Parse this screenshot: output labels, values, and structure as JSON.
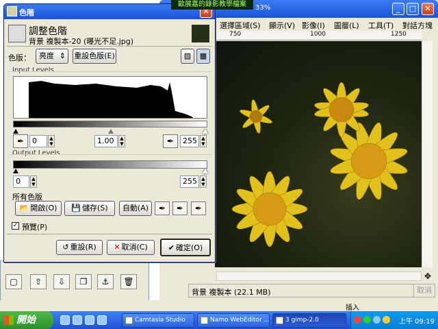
{
  "banner": {
    "text": "歐展嘉的錄影教學檔案"
  },
  "image_window": {
    "title_fragment": "33%",
    "menu": [
      "選擇區域(S)",
      "顯示(V)",
      "影像(I)",
      "圖層(L)",
      "工具(T)",
      "對話方塊"
    ],
    "ruler_ticks": [
      "750",
      "1000",
      "1250"
    ],
    "status": "背景 複製本 (22.1 MB)",
    "cancel": "取消"
  },
  "dialog": {
    "title": "色階",
    "header_title": "調整色階",
    "header_subtitle": "背景 複製本-20 (曝光不足.jpg)",
    "channel_label": "色版：",
    "channel_value": "亮度",
    "reset_channel": "重設色版(E)",
    "input_levels_label": "Input Levels",
    "input_low": "0",
    "input_gamma": "1.00",
    "input_high": "255",
    "output_levels_label": "Output Levels",
    "output_low": "0",
    "output_high": "255",
    "all_channels_label": "所有色版",
    "open_label": "開啟(O)",
    "save_label": "儲存(S)",
    "auto_label": "自動(A)",
    "preview_label": "預覽(P)",
    "reset_label": "重設(R)",
    "cancel_label": "取消(C)",
    "ok_label": "確定(O)"
  },
  "taskbar": {
    "start": "開始",
    "tasks": [
      "Camtasia Studio",
      "Namo WebEditor ...",
      "3 gimp-2.0"
    ],
    "insert": "插入",
    "clock": "上午 09:19"
  },
  "colors": {
    "xp_blue": "#1b52d8",
    "dialog_bg": "#ece9d8",
    "flower": "#e8c21a"
  }
}
